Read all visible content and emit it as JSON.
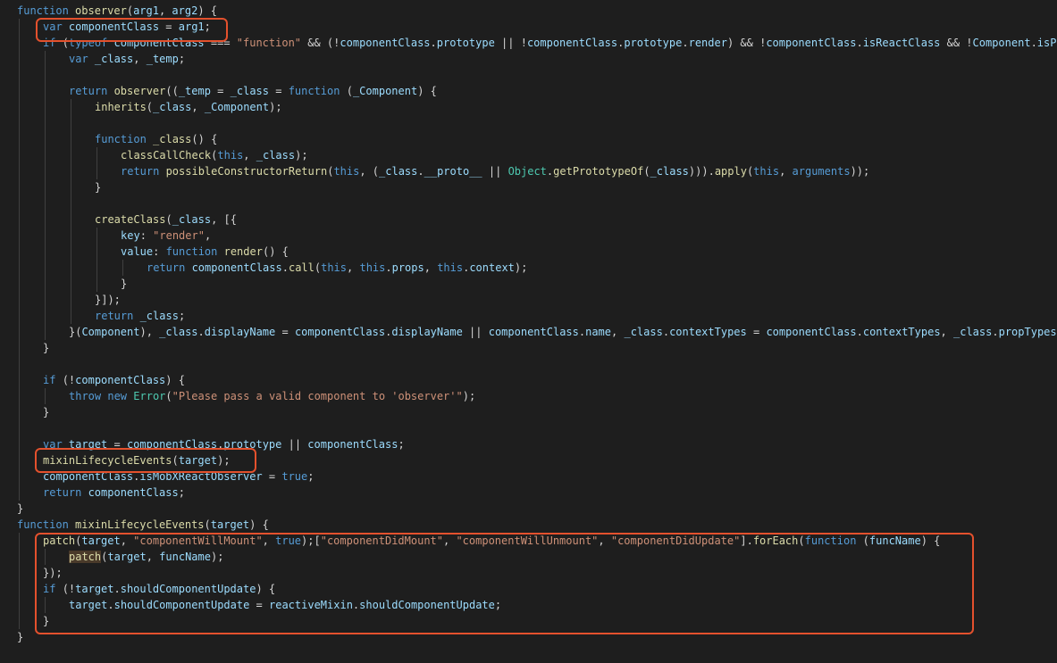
{
  "editor": {
    "language": "javascript",
    "colors": {
      "background": "#1e1e1e",
      "keyword": "#569cd6",
      "variable": "#9cdcfe",
      "function": "#dcdcaa",
      "string": "#ce9178",
      "class": "#4ec9b0",
      "punctuation": "#d4d4d4",
      "annotation": "#e4512d"
    },
    "lines": [
      {
        "indent": 0,
        "tokens": [
          [
            "k",
            "function "
          ],
          [
            "f",
            "observer"
          ],
          [
            "p",
            "("
          ],
          [
            "v",
            "arg1"
          ],
          [
            "p",
            ", "
          ],
          [
            "v",
            "arg2"
          ],
          [
            "p",
            ") {"
          ]
        ]
      },
      {
        "indent": 1,
        "tokens": [
          [
            "k",
            "var "
          ],
          [
            "v",
            "componentClass"
          ],
          [
            "p",
            " = "
          ],
          [
            "v",
            "arg1"
          ],
          [
            "p",
            ";"
          ]
        ]
      },
      {
        "indent": 1,
        "tokens": [
          [
            "k",
            "if "
          ],
          [
            "p",
            "("
          ],
          [
            "k",
            "typeof "
          ],
          [
            "v",
            "componentClass"
          ],
          [
            "p",
            " === "
          ],
          [
            "s",
            "\"function\""
          ],
          [
            "p",
            " && (!"
          ],
          [
            "v",
            "componentClass"
          ],
          [
            "p",
            "."
          ],
          [
            "v",
            "prototype"
          ],
          [
            "p",
            " || !"
          ],
          [
            "v",
            "componentClass"
          ],
          [
            "p",
            "."
          ],
          [
            "v",
            "prototype"
          ],
          [
            "p",
            "."
          ],
          [
            "v",
            "render"
          ],
          [
            "p",
            ") && !"
          ],
          [
            "v",
            "componentClass"
          ],
          [
            "p",
            "."
          ],
          [
            "v",
            "isReactClass"
          ],
          [
            "p",
            " && !"
          ],
          [
            "v",
            "Component"
          ],
          [
            "p",
            "."
          ],
          [
            "v",
            "isP"
          ]
        ]
      },
      {
        "indent": 2,
        "tokens": [
          [
            "k",
            "var "
          ],
          [
            "v",
            "_class"
          ],
          [
            "p",
            ", "
          ],
          [
            "v",
            "_temp"
          ],
          [
            "p",
            ";"
          ]
        ]
      },
      {
        "indent": 2,
        "tokens": []
      },
      {
        "indent": 2,
        "tokens": [
          [
            "k",
            "return "
          ],
          [
            "f",
            "observer"
          ],
          [
            "p",
            "(("
          ],
          [
            "v",
            "_temp"
          ],
          [
            "p",
            " = "
          ],
          [
            "v",
            "_class"
          ],
          [
            "p",
            " = "
          ],
          [
            "k",
            "function "
          ],
          [
            "p",
            "("
          ],
          [
            "v",
            "_Component"
          ],
          [
            "p",
            ") {"
          ]
        ]
      },
      {
        "indent": 3,
        "tokens": [
          [
            "f",
            "inherits"
          ],
          [
            "p",
            "("
          ],
          [
            "v",
            "_class"
          ],
          [
            "p",
            ", "
          ],
          [
            "v",
            "_Component"
          ],
          [
            "p",
            ");"
          ]
        ]
      },
      {
        "indent": 3,
        "tokens": []
      },
      {
        "indent": 3,
        "tokens": [
          [
            "k",
            "function "
          ],
          [
            "f",
            "_class"
          ],
          [
            "p",
            "() {"
          ]
        ]
      },
      {
        "indent": 4,
        "tokens": [
          [
            "f",
            "classCallCheck"
          ],
          [
            "p",
            "("
          ],
          [
            "k",
            "this"
          ],
          [
            "p",
            ", "
          ],
          [
            "v",
            "_class"
          ],
          [
            "p",
            ");"
          ]
        ]
      },
      {
        "indent": 4,
        "tokens": [
          [
            "k",
            "return "
          ],
          [
            "f",
            "possibleConstructorReturn"
          ],
          [
            "p",
            "("
          ],
          [
            "k",
            "this"
          ],
          [
            "p",
            ", ("
          ],
          [
            "v",
            "_class"
          ],
          [
            "p",
            "."
          ],
          [
            "v",
            "__proto__"
          ],
          [
            "p",
            " || "
          ],
          [
            "c",
            "Object"
          ],
          [
            "p",
            "."
          ],
          [
            "f",
            "getPrototypeOf"
          ],
          [
            "p",
            "("
          ],
          [
            "v",
            "_class"
          ],
          [
            "p",
            ")))."
          ],
          [
            "f",
            "apply"
          ],
          [
            "p",
            "("
          ],
          [
            "k",
            "this"
          ],
          [
            "p",
            ", "
          ],
          [
            "k",
            "arguments"
          ],
          [
            "p",
            "));"
          ]
        ]
      },
      {
        "indent": 3,
        "tokens": [
          [
            "p",
            "}"
          ]
        ]
      },
      {
        "indent": 3,
        "tokens": []
      },
      {
        "indent": 3,
        "tokens": [
          [
            "f",
            "createClass"
          ],
          [
            "p",
            "("
          ],
          [
            "v",
            "_class"
          ],
          [
            "p",
            ", [{"
          ]
        ]
      },
      {
        "indent": 4,
        "tokens": [
          [
            "v",
            "key"
          ],
          [
            "p",
            ": "
          ],
          [
            "s",
            "\"render\""
          ],
          [
            "p",
            ","
          ]
        ]
      },
      {
        "indent": 4,
        "tokens": [
          [
            "v",
            "value"
          ],
          [
            "p",
            ": "
          ],
          [
            "k",
            "function "
          ],
          [
            "f",
            "render"
          ],
          [
            "p",
            "() {"
          ]
        ]
      },
      {
        "indent": 5,
        "tokens": [
          [
            "k",
            "return "
          ],
          [
            "v",
            "componentClass"
          ],
          [
            "p",
            "."
          ],
          [
            "f",
            "call"
          ],
          [
            "p",
            "("
          ],
          [
            "k",
            "this"
          ],
          [
            "p",
            ", "
          ],
          [
            "k",
            "this"
          ],
          [
            "p",
            "."
          ],
          [
            "v",
            "props"
          ],
          [
            "p",
            ", "
          ],
          [
            "k",
            "this"
          ],
          [
            "p",
            "."
          ],
          [
            "v",
            "context"
          ],
          [
            "p",
            ");"
          ]
        ]
      },
      {
        "indent": 4,
        "tokens": [
          [
            "p",
            "}"
          ]
        ]
      },
      {
        "indent": 3,
        "tokens": [
          [
            "p",
            "}]);"
          ]
        ]
      },
      {
        "indent": 3,
        "tokens": [
          [
            "k",
            "return "
          ],
          [
            "v",
            "_class"
          ],
          [
            "p",
            ";"
          ]
        ]
      },
      {
        "indent": 2,
        "tokens": [
          [
            "p",
            "}("
          ],
          [
            "v",
            "Component"
          ],
          [
            "p",
            "), "
          ],
          [
            "v",
            "_class"
          ],
          [
            "p",
            "."
          ],
          [
            "v",
            "displayName"
          ],
          [
            "p",
            " = "
          ],
          [
            "v",
            "componentClass"
          ],
          [
            "p",
            "."
          ],
          [
            "v",
            "displayName"
          ],
          [
            "p",
            " || "
          ],
          [
            "v",
            "componentClass"
          ],
          [
            "p",
            "."
          ],
          [
            "v",
            "name"
          ],
          [
            "p",
            ", "
          ],
          [
            "v",
            "_class"
          ],
          [
            "p",
            "."
          ],
          [
            "v",
            "contextTypes"
          ],
          [
            "p",
            " = "
          ],
          [
            "v",
            "componentClass"
          ],
          [
            "p",
            "."
          ],
          [
            "v",
            "contextTypes"
          ],
          [
            "p",
            ", "
          ],
          [
            "v",
            "_class"
          ],
          [
            "p",
            "."
          ],
          [
            "v",
            "propTypes"
          ]
        ]
      },
      {
        "indent": 1,
        "tokens": [
          [
            "p",
            "}"
          ]
        ]
      },
      {
        "indent": 1,
        "tokens": []
      },
      {
        "indent": 1,
        "tokens": [
          [
            "k",
            "if "
          ],
          [
            "p",
            "(!"
          ],
          [
            "v",
            "componentClass"
          ],
          [
            "p",
            ") {"
          ]
        ]
      },
      {
        "indent": 2,
        "tokens": [
          [
            "k",
            "throw "
          ],
          [
            "k",
            "new "
          ],
          [
            "c",
            "Error"
          ],
          [
            "p",
            "("
          ],
          [
            "s",
            "\"Please pass a valid component to 'observer'\""
          ],
          [
            "p",
            ");"
          ]
        ]
      },
      {
        "indent": 1,
        "tokens": [
          [
            "p",
            "}"
          ]
        ]
      },
      {
        "indent": 1,
        "tokens": []
      },
      {
        "indent": 1,
        "tokens": [
          [
            "k",
            "var "
          ],
          [
            "v",
            "target"
          ],
          [
            "p",
            " = "
          ],
          [
            "v",
            "componentClass"
          ],
          [
            "p",
            "."
          ],
          [
            "v",
            "prototype"
          ],
          [
            "p",
            " || "
          ],
          [
            "v",
            "componentClass"
          ],
          [
            "p",
            ";"
          ]
        ]
      },
      {
        "indent": 1,
        "tokens": [
          [
            "f",
            "mixinLifecycleEvents"
          ],
          [
            "p",
            "("
          ],
          [
            "v",
            "target"
          ],
          [
            "p",
            ");"
          ]
        ]
      },
      {
        "indent": 1,
        "tokens": [
          [
            "v",
            "componentClass"
          ],
          [
            "p",
            "."
          ],
          [
            "v",
            "isMobXReactObserver"
          ],
          [
            "p",
            " = "
          ],
          [
            "k",
            "true"
          ],
          [
            "p",
            ";"
          ]
        ]
      },
      {
        "indent": 1,
        "tokens": [
          [
            "k",
            "return "
          ],
          [
            "v",
            "componentClass"
          ],
          [
            "p",
            ";"
          ]
        ]
      },
      {
        "indent": 0,
        "tokens": [
          [
            "p",
            "}"
          ]
        ]
      },
      {
        "indent": 0,
        "tokens": [
          [
            "k",
            "function "
          ],
          [
            "f",
            "mixinLifecycleEvents"
          ],
          [
            "p",
            "("
          ],
          [
            "v",
            "target"
          ],
          [
            "p",
            ") {"
          ]
        ]
      },
      {
        "indent": 1,
        "tokens": [
          [
            "f",
            "patch"
          ],
          [
            "p",
            "("
          ],
          [
            "v",
            "target"
          ],
          [
            "p",
            ", "
          ],
          [
            "s",
            "\"componentWillMount\""
          ],
          [
            "p",
            ", "
          ],
          [
            "k",
            "true"
          ],
          [
            "p",
            ");["
          ],
          [
            "s",
            "\"componentDidMount\""
          ],
          [
            "p",
            ", "
          ],
          [
            "s",
            "\"componentWillUnmount\""
          ],
          [
            "p",
            ", "
          ],
          [
            "s",
            "\"componentDidUpdate\""
          ],
          [
            "p",
            "]."
          ],
          [
            "f",
            "forEach"
          ],
          [
            "p",
            "("
          ],
          [
            "k",
            "function "
          ],
          [
            "p",
            "("
          ],
          [
            "v",
            "funcName"
          ],
          [
            "p",
            ") {"
          ]
        ]
      },
      {
        "indent": 2,
        "tokens": [
          [
            "f",
            "patch"
          ],
          [
            "p",
            "("
          ],
          [
            "v",
            "target"
          ],
          [
            "p",
            ", "
          ],
          [
            "v",
            "funcName"
          ],
          [
            "p",
            ");"
          ]
        ]
      },
      {
        "indent": 1,
        "tokens": [
          [
            "p",
            "});"
          ]
        ]
      },
      {
        "indent": 1,
        "tokens": [
          [
            "k",
            "if "
          ],
          [
            "p",
            "(!"
          ],
          [
            "v",
            "target"
          ],
          [
            "p",
            "."
          ],
          [
            "v",
            "shouldComponentUpdate"
          ],
          [
            "p",
            ") {"
          ]
        ]
      },
      {
        "indent": 2,
        "tokens": [
          [
            "v",
            "target"
          ],
          [
            "p",
            "."
          ],
          [
            "v",
            "shouldComponentUpdate"
          ],
          [
            "p",
            " = "
          ],
          [
            "v",
            "reactiveMixin"
          ],
          [
            "p",
            "."
          ],
          [
            "v",
            "shouldComponentUpdate"
          ],
          [
            "p",
            ";"
          ]
        ]
      },
      {
        "indent": 1,
        "tokens": [
          [
            "p",
            "}"
          ]
        ]
      },
      {
        "indent": 0,
        "tokens": [
          [
            "p",
            "}"
          ]
        ]
      }
    ]
  }
}
